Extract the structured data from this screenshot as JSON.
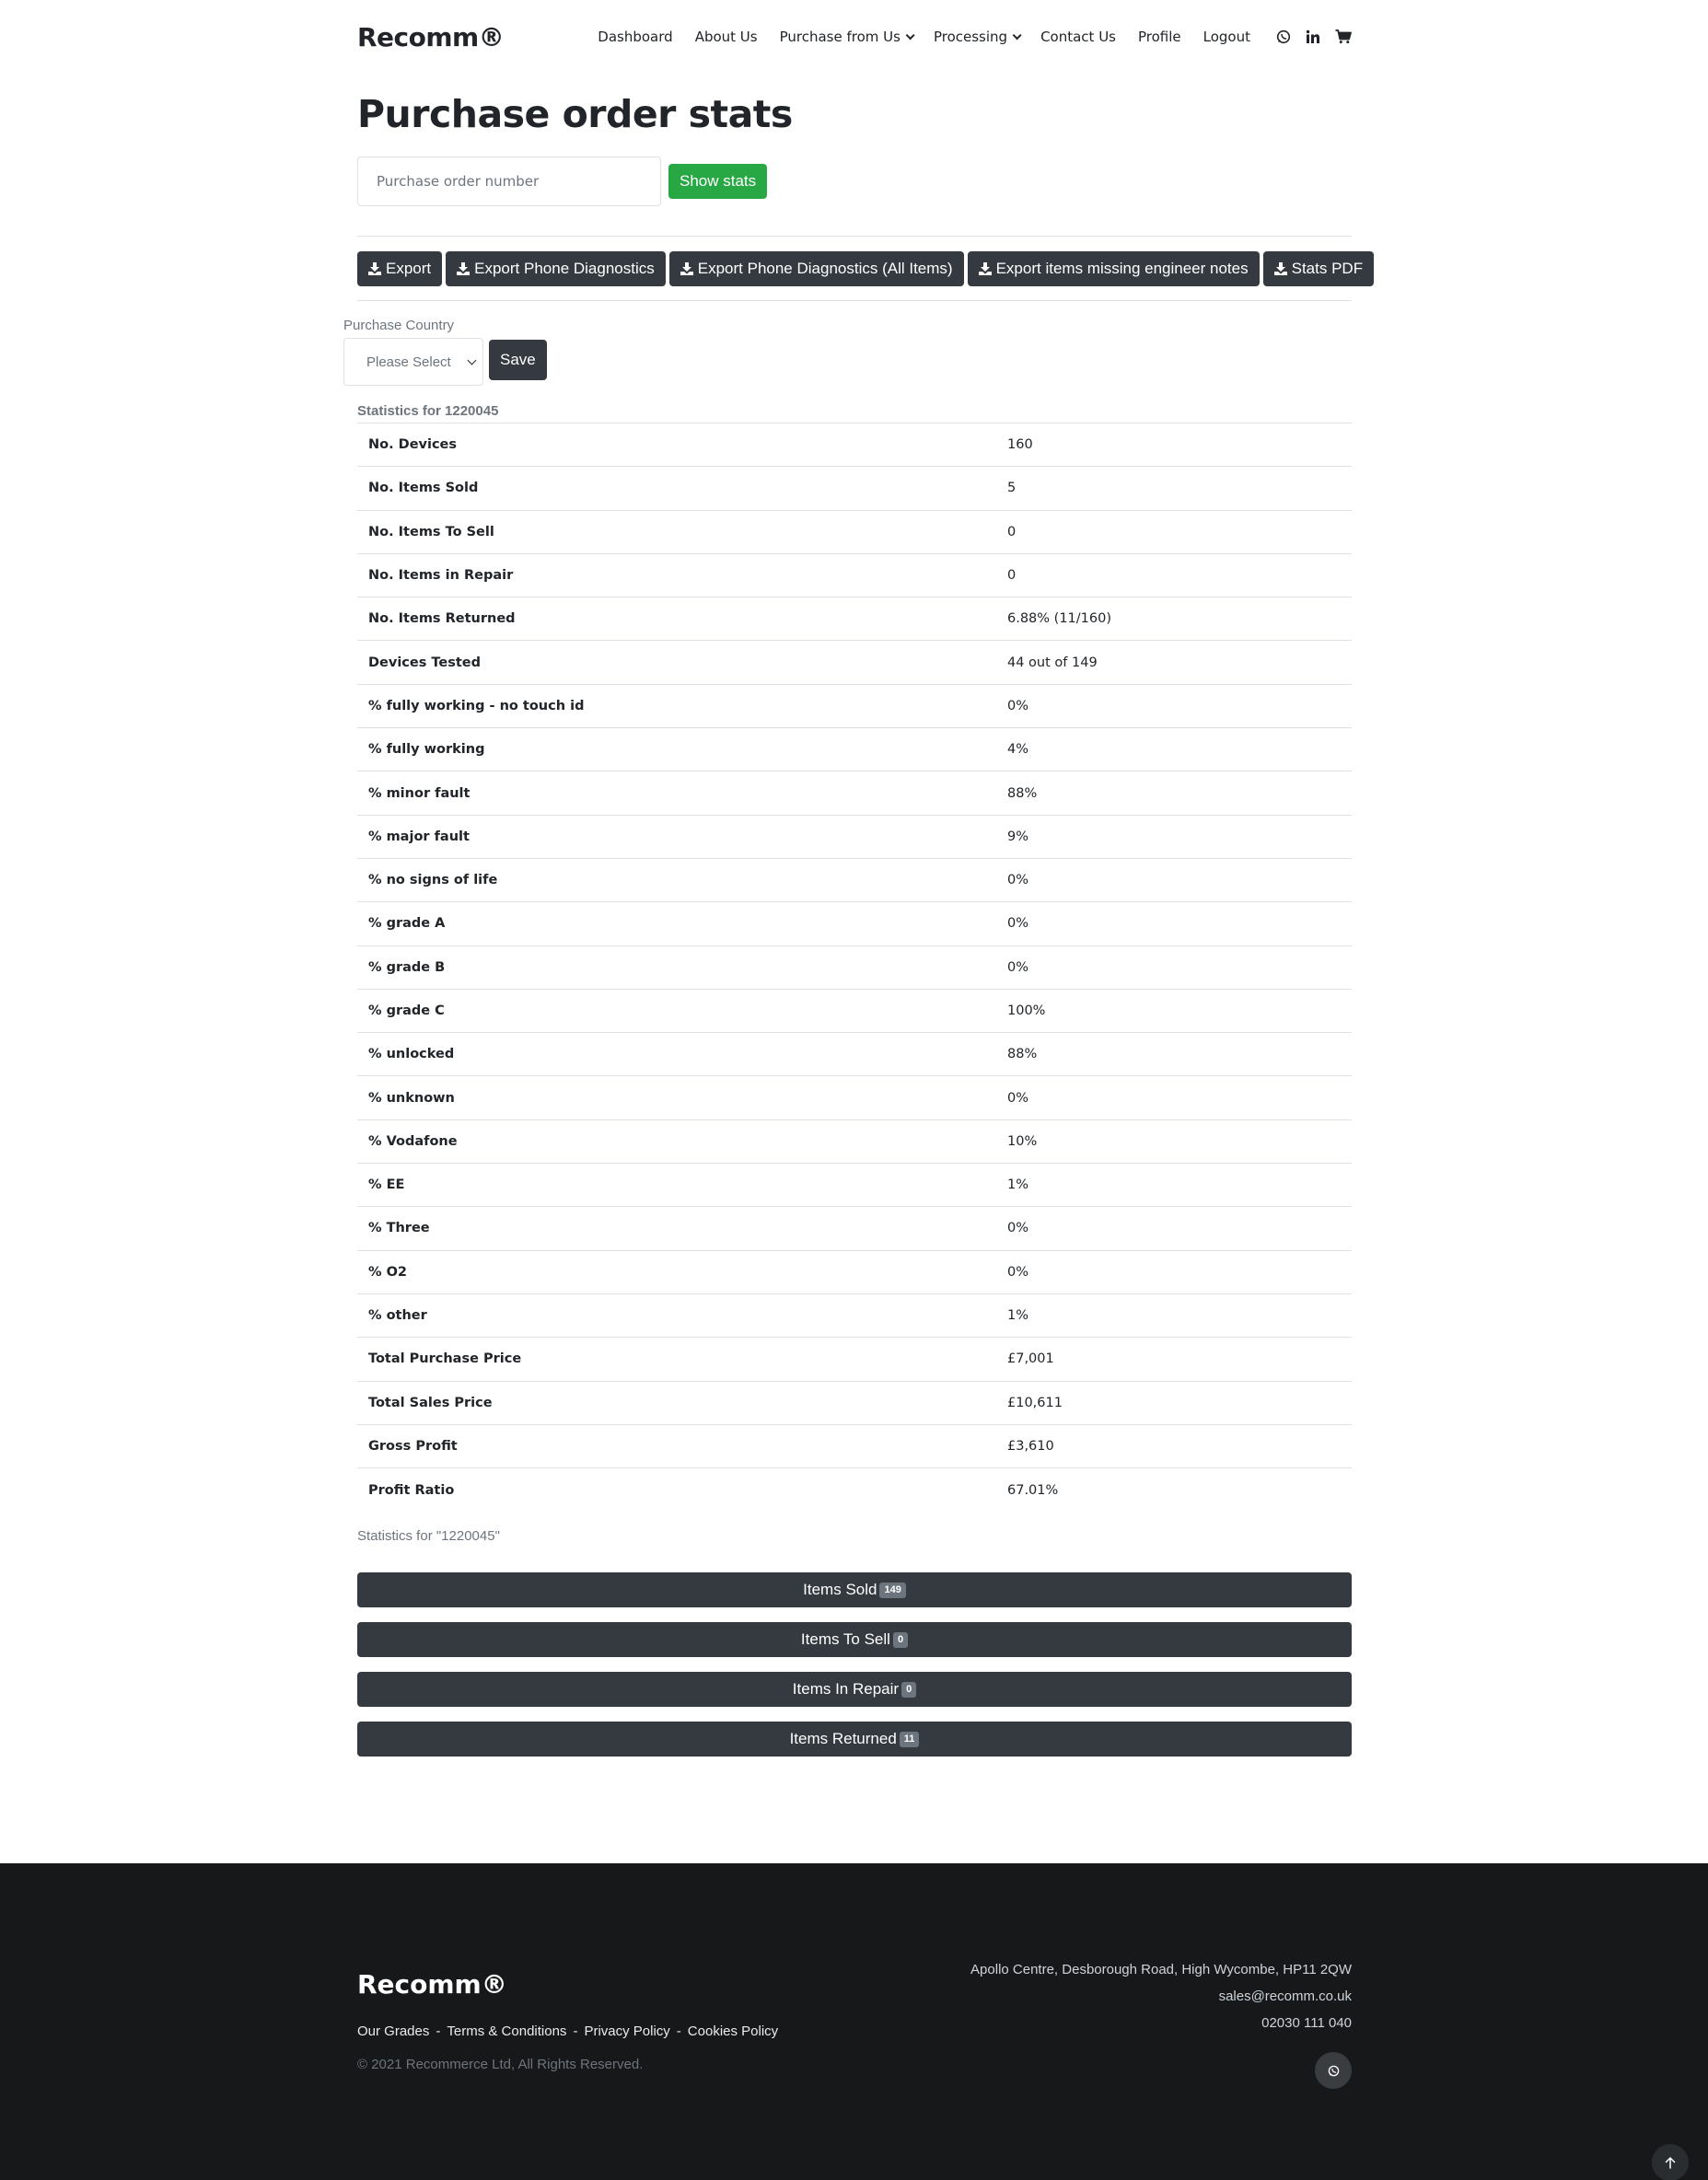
{
  "header": {
    "logo": "Recomm®",
    "nav": [
      {
        "label": "Dashboard",
        "dropdown": false
      },
      {
        "label": "About Us",
        "dropdown": false
      },
      {
        "label": "Purchase from Us",
        "dropdown": true
      },
      {
        "label": "Processing",
        "dropdown": true
      },
      {
        "label": "Contact Us",
        "dropdown": false
      },
      {
        "label": "Profile",
        "dropdown": false
      },
      {
        "label": "Logout",
        "dropdown": false
      }
    ],
    "icons": [
      "whatsapp-icon",
      "linkedin-icon",
      "cart-icon"
    ]
  },
  "page": {
    "title": "Purchase order stats",
    "search_placeholder": "Purchase order number",
    "show_stats_label": "Show stats"
  },
  "exports": [
    "Export",
    "Export Phone Diagnostics",
    "Export Phone Diagnostics (All Items)",
    "Export items missing engineer notes",
    "Stats PDF"
  ],
  "country": {
    "label": "Purchase Country",
    "selected": "Please Select",
    "save_label": "Save"
  },
  "stats": {
    "caption": "Statistics for 1220045",
    "rows": [
      [
        "No. Devices",
        "160"
      ],
      [
        "No. Items Sold",
        "5"
      ],
      [
        "No. Items To Sell",
        "0"
      ],
      [
        "No. Items in Repair",
        "0"
      ],
      [
        "No. Items Returned",
        "6.88% (11/160)"
      ],
      [
        "Devices Tested",
        "44 out of 149"
      ],
      [
        "% fully working - no touch id",
        "0%"
      ],
      [
        "% fully working",
        "4%"
      ],
      [
        "% minor fault",
        "88%"
      ],
      [
        "% major fault",
        "9%"
      ],
      [
        "% no signs of life",
        "0%"
      ],
      [
        "% grade A",
        "0%"
      ],
      [
        "% grade B",
        "0%"
      ],
      [
        "% grade C",
        "100%"
      ],
      [
        "% unlocked",
        "88%"
      ],
      [
        "% unknown",
        "0%"
      ],
      [
        "% Vodafone",
        "10%"
      ],
      [
        "% EE",
        "1%"
      ],
      [
        "% Three",
        "0%"
      ],
      [
        "% O2",
        "0%"
      ],
      [
        "% other",
        "1%"
      ],
      [
        "Total Purchase Price",
        "£7,001"
      ],
      [
        "Total Sales Price",
        "£10,611"
      ],
      [
        "Gross Profit",
        "£3,610"
      ],
      [
        "Profit Ratio",
        "67.01%"
      ]
    ],
    "footnote": "Statistics for \"1220045\""
  },
  "item_buttons": [
    {
      "label": "Items Sold",
      "count": "149"
    },
    {
      "label": "Items To Sell",
      "count": "0"
    },
    {
      "label": "Items In Repair",
      "count": "0"
    },
    {
      "label": "Items Returned",
      "count": "11"
    }
  ],
  "footer": {
    "logo": "Recomm®",
    "links": [
      "Our Grades",
      "Terms & Conditions",
      "Privacy Policy",
      "Cookies Policy"
    ],
    "link_separator": "-",
    "copyright": "© 2021 Recommerce Ltd, All Rights Reserved.",
    "address": "Apollo Centre, Desborough Road, High Wycombe, HP11 2QW",
    "email": "sales@recomm.co.uk",
    "phone": "02030 111 040"
  },
  "colors": {
    "success": "#28a745",
    "dark": "#343a40",
    "footer_bg": "#161819",
    "badge": "#6c757d"
  }
}
